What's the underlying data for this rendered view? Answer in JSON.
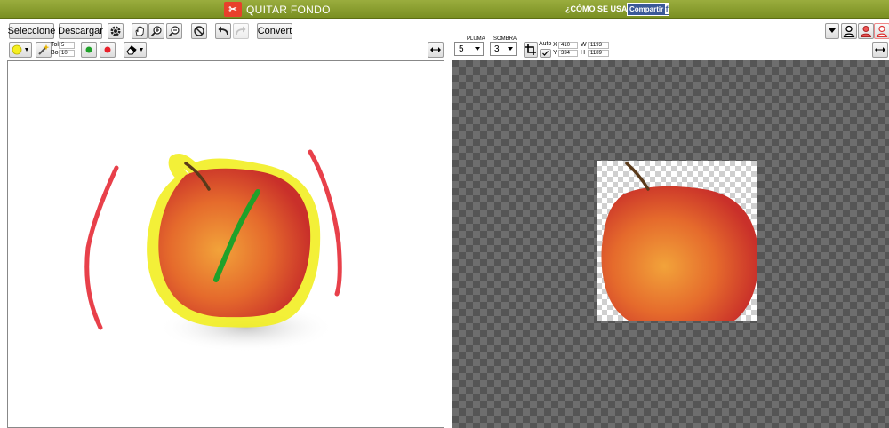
{
  "header": {
    "logo_mark": "✂",
    "app_name": "QUITAR FONDO",
    "how_to": "¿CÓMO SE USA?",
    "share_label": "Compartir",
    "share_icon": "f"
  },
  "toolbar": {
    "select_label": "Seleccione",
    "download_label": "Descargar",
    "convert_label": "Convert",
    "tol_label": "Tol",
    "tol_value": "5",
    "bor_label": "Bor",
    "bor_value": "10"
  },
  "brush": {
    "pluma_label": "PLUMA",
    "pluma_value": "5",
    "sombra_label": "SOMBRA",
    "sombra_value": "3"
  },
  "crop": {
    "auto_label": "Auto",
    "x_label": "X",
    "x_value": "410",
    "y_label": "Y",
    "y_value": "334",
    "w_label": "W",
    "w_value": "1193",
    "h_label": "H",
    "h_value": "1189"
  },
  "colors": {
    "header_green": "#8a9f2e",
    "keep_marker": "#1fa12a",
    "remove_marker": "#e8404a",
    "selection_yellow": "#f2ee22"
  }
}
